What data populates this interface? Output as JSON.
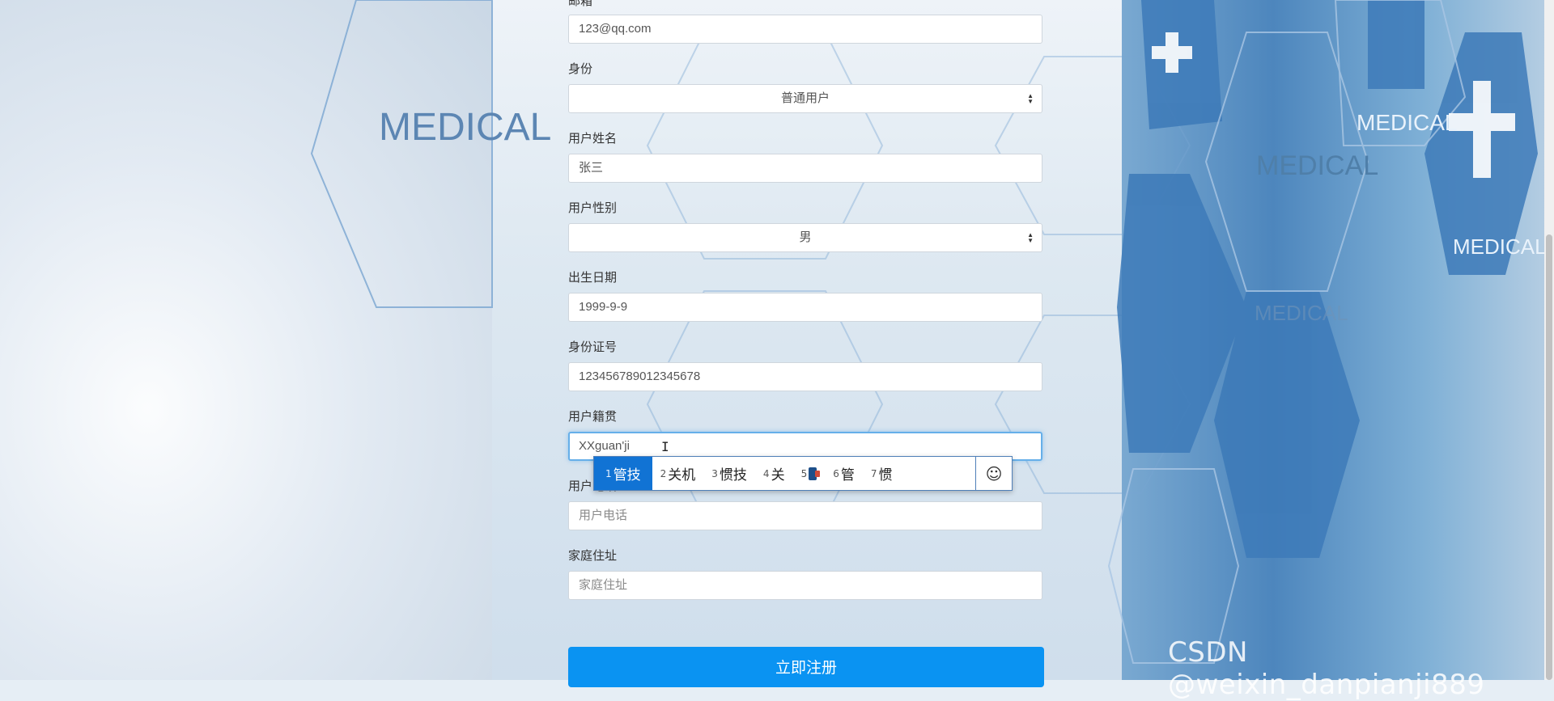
{
  "background": {
    "medical_labels": [
      "MEDICAL",
      "MEDICAL",
      "MEDICAL",
      "MEDICAL",
      "MEDICAL"
    ],
    "colors": {
      "accent": "#0a93f2",
      "hex_blue": "#4d86bd"
    }
  },
  "form": {
    "email": {
      "label": "邮箱",
      "value": "123@qq.com"
    },
    "identity": {
      "label": "身份",
      "value": "普通用户"
    },
    "name": {
      "label": "用户姓名",
      "value": "张三"
    },
    "gender": {
      "label": "用户性别",
      "value": "男"
    },
    "birthdate": {
      "label": "出生日期",
      "value": "1999-9-9"
    },
    "id_number": {
      "label": "身份证号",
      "value": "123456789012345678"
    },
    "native_place": {
      "label": "用户籍贯",
      "value": "XXguan'ji"
    },
    "phone": {
      "label": "用户电话",
      "placeholder": "用户电话"
    },
    "address": {
      "label": "家庭住址",
      "placeholder": "家庭住址"
    },
    "submit_label": "立即注册"
  },
  "ime": {
    "candidates": [
      {
        "num": "1",
        "text": "管技",
        "selected": true
      },
      {
        "num": "2",
        "text": "关机"
      },
      {
        "num": "3",
        "text": "惯技"
      },
      {
        "num": "4",
        "text": "关"
      },
      {
        "num": "5",
        "icon": "phone-emoji-icon"
      },
      {
        "num": "6",
        "text": "管"
      },
      {
        "num": "7",
        "text": "惯"
      }
    ],
    "emoji_button_icon": "smiley-icon"
  },
  "watermark": "CSDN @weixin_danpianji889"
}
